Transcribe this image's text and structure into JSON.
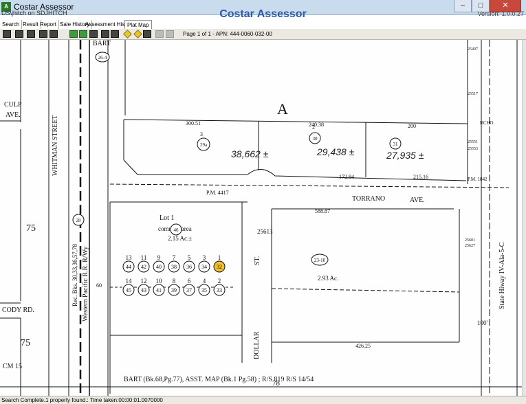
{
  "window": {
    "title": "Costar Assessor",
    "app_icon": "app-icon",
    "buttons": [
      "minimize",
      "maximize",
      "close"
    ]
  },
  "header": {
    "user": "US\\jhitch on SDJHITCH",
    "brand": "Costar Assessor",
    "version": "Version: 1.0.0.27"
  },
  "tabs": [
    {
      "label": "Search"
    },
    {
      "label": "Result"
    },
    {
      "label": "Report"
    },
    {
      "label": "Plat Map"
    },
    {
      "label": "Sale History"
    },
    {
      "label": "Assessment History"
    },
    {
      "label": "Plat Map",
      "active": true
    }
  ],
  "toolbar": {
    "page_info": "Page 1 of 1 - APN: 444-0060-032-00"
  },
  "status": {
    "text": "Search Complete.1 property found.: Time taken:00:00:01.0070000"
  },
  "map": {
    "block_letter": "A",
    "labels": {
      "culp": "CULP",
      "culp_ave": "AVE.",
      "whitman": "WHITMAN STREET",
      "bart": "BART",
      "bart_num": "26-4",
      "rr": "Western Pacific R.R. R/Wy",
      "rec": "Rec. Bks. 30,33,36,57,78",
      "torrano": "TORRANO",
      "torrano_ave": "AVE.",
      "dollar": "DOLLAR",
      "st": "ST.",
      "cody": "CODY RD.",
      "cm15": "CM 15",
      "n75a": "75",
      "n75b": "75",
      "n28": "28",
      "n78": "78",
      "state_hwy": "State Hiway IV-Ala-5-C",
      "n100": "100'",
      "lot1": "Lot 1",
      "common_area": "common area",
      "area_215": "2.15 Ac.±",
      "area_293": "2.93 Ac.",
      "p3": "3",
      "p2": "2",
      "a38662": "38,662 ±",
      "a29438": "29,438 ±",
      "a27935": "27,935 ±",
      "pm4417": "P.M. 4417",
      "pm1842": "P.M. 1842",
      "rcho": "RCHO.",
      "footer": "BART (Bk.68,Pg.77), ASST. MAP (Bk.1 Pg.58) ; R/S 819 R/S 14/54"
    },
    "circles": [
      {
        "id": "29a",
        "label": "29a"
      },
      {
        "id": "30",
        "label": "30"
      },
      {
        "id": "31",
        "label": "31"
      },
      {
        "id": "46",
        "label": "46"
      },
      {
        "id": "28",
        "label": "28"
      },
      {
        "id": "26-4",
        "label": "26-4"
      },
      {
        "id": "23-10",
        "label": "23-10"
      }
    ],
    "lots_top": [
      {
        "num": "13",
        "parcel": "44"
      },
      {
        "num": "11",
        "parcel": "42"
      },
      {
        "num": "9",
        "parcel": "40"
      },
      {
        "num": "7",
        "parcel": "38"
      },
      {
        "num": "5",
        "parcel": "36"
      },
      {
        "num": "3",
        "parcel": "34"
      },
      {
        "num": "1",
        "parcel": "32",
        "highlight": true
      }
    ],
    "lots_bottom": [
      {
        "num": "14",
        "parcel": "45"
      },
      {
        "num": "12",
        "parcel": "43"
      },
      {
        "num": "10",
        "parcel": "41"
      },
      {
        "num": "8",
        "parcel": "39"
      },
      {
        "num": "6",
        "parcel": "37"
      },
      {
        "num": "4",
        "parcel": "35"
      },
      {
        "num": "2",
        "parcel": "33"
      }
    ],
    "side_numbers": [
      "25497",
      "25517",
      "25551",
      "25553",
      "25601",
      "25627",
      "25613"
    ],
    "dims": [
      "300.51",
      "240.38",
      "200",
      "172.84",
      "215.16",
      "588.87",
      "426.25",
      "60"
    ],
    "highlight_color": "#f2c12e"
  }
}
